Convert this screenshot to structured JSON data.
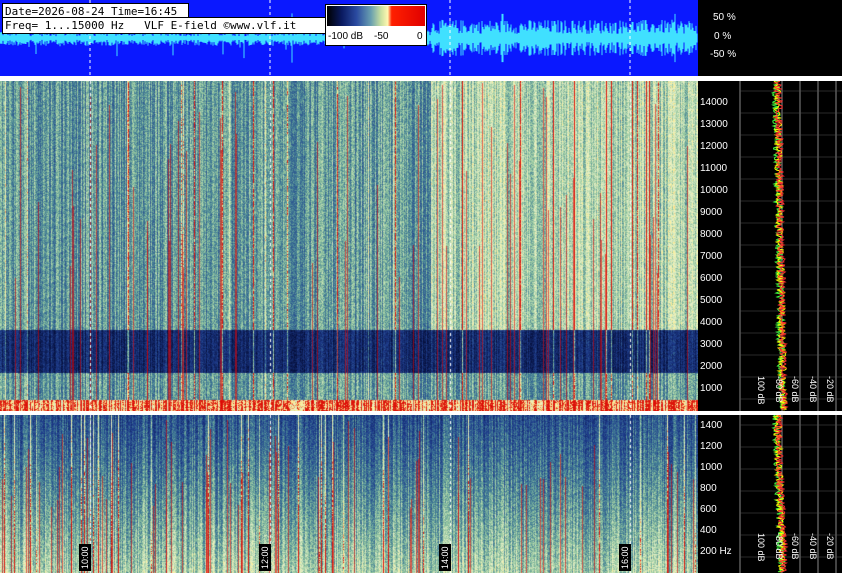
{
  "header": {
    "date_time": "Date=2026-08-24 Time=16:45",
    "freq_info": "Freq= 1...15000 Hz   VLF E-field ©www.vlf.it"
  },
  "colorbar": {
    "labels": [
      "-100 dB",
      "-50",
      "0"
    ]
  },
  "amplitude_axis": [
    "50 %",
    "0 %",
    "-50 %"
  ],
  "upper_freq_axis": [
    "14000",
    "13000",
    "12000",
    "11000",
    "10000",
    "9000",
    "8000",
    "7000",
    "6000",
    "5000",
    "4000",
    "3000",
    "2000",
    "1000"
  ],
  "lower_freq_axis": [
    "1400",
    "1200",
    "1000",
    "800",
    "600",
    "400",
    "200 Hz"
  ],
  "upper_db_axis": [
    "100 dB",
    "-80 dB",
    "-60 dB",
    "-40 dB",
    "-20 dB"
  ],
  "lower_db_axis": [
    "100 dB",
    "-80 dB",
    "-60 dB",
    "-40 dB",
    "-20 dB"
  ],
  "time_axis": [
    "10:00",
    "12:00",
    "14:00",
    "16:00"
  ],
  "colors": {
    "wave_bg": "#0a18ff",
    "wave": "#40e0ff",
    "accent_red": "#e00000",
    "trace_yellow": "#ffff00",
    "trace_green": "#40ff40",
    "trace_red": "#ff3030"
  }
}
